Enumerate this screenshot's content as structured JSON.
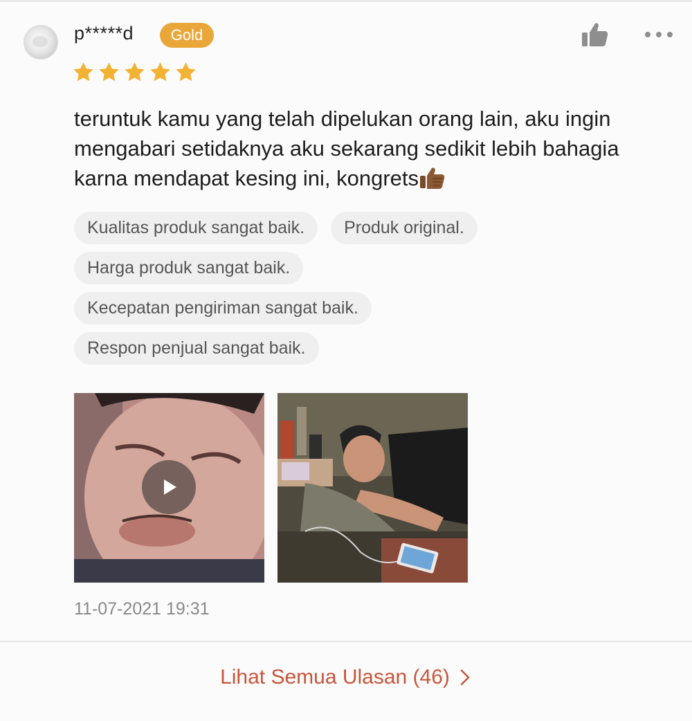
{
  "review": {
    "username": "p*****d",
    "badge": "Gold",
    "rating": 5,
    "text": "teruntuk kamu yang telah dipelukan orang lain, aku ingin mengabari setidaknya aku sekarang sedikit lebih bahagia karna mendapat kesing ini, kongrets",
    "tags": [
      [
        "Kualitas produk sangat baik.",
        "Produk original."
      ],
      [
        "Harga produk sangat baik."
      ],
      [
        "Kecepatan pengiriman sangat baik."
      ],
      [
        "Respon penjual sangat baik."
      ]
    ],
    "timestamp": "11-07-2021 19:31"
  },
  "footer": {
    "see_all_label": "Lihat Semua Ulasan (46)"
  },
  "icons": {
    "like": "thumbs-up-icon",
    "more": "more-dots-icon",
    "star": "star-icon",
    "play": "play-icon",
    "chevron": "chevron-right-icon",
    "emoji": "thumbs-up-emoji"
  },
  "colors": {
    "badge": "#e9a73a",
    "star": "#f2b233",
    "link": "#c8553a",
    "tag_bg": "#efefef"
  }
}
